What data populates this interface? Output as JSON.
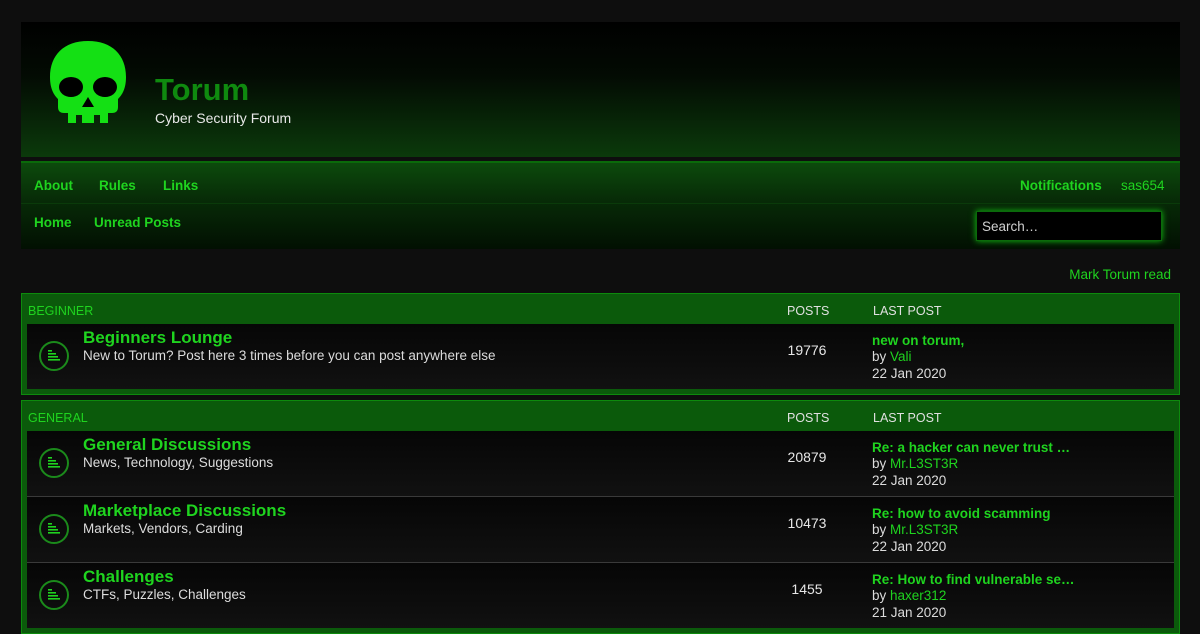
{
  "header": {
    "title": "Torum",
    "subtitle": "Cyber Security Forum",
    "logo_icon": "skull-icon"
  },
  "nav": {
    "about": "About",
    "rules": "Rules",
    "links": "Links",
    "notifications": "Notifications",
    "username": "sas654",
    "home": "Home",
    "unread": "Unread Posts",
    "search_placeholder": "Search…"
  },
  "mark_read": "Mark Torum read",
  "colors": {
    "accent": "#1fd41f",
    "dark_green": "#0f8a0f",
    "background": "#0e0e0e"
  },
  "sections": [
    {
      "title": "BEGINNER",
      "posts_header": "POSTS",
      "last_post_header": "LAST POST",
      "forums": [
        {
          "title": "Beginners Lounge",
          "description": "New to Torum? Post here 3 times before you can post anywhere else",
          "posts": "19776",
          "last_post": {
            "title": "new on torum,",
            "by": "by",
            "user": "Vali",
            "date": "22 Jan 2020"
          }
        }
      ]
    },
    {
      "title": "GENERAL",
      "posts_header": "POSTS",
      "last_post_header": "LAST POST",
      "forums": [
        {
          "title": "General Discussions",
          "description": "News, Technology, Suggestions",
          "posts": "20879",
          "last_post": {
            "title": "Re: a hacker can never trust …",
            "by": "by",
            "user": "Mr.L3ST3R",
            "date": "22 Jan 2020"
          }
        },
        {
          "title": "Marketplace Discussions",
          "description": "Markets, Vendors, Carding",
          "posts": "10473",
          "last_post": {
            "title": "Re: how to avoid scamming",
            "by": "by",
            "user": "Mr.L3ST3R",
            "date": "22 Jan 2020"
          }
        },
        {
          "title": "Challenges",
          "description": "CTFs, Puzzles, Challenges",
          "posts": "1455",
          "last_post": {
            "title": "Re: How to find vulnerable se…",
            "by": "by",
            "user": "haxer312",
            "date": "21 Jan 2020"
          }
        }
      ]
    }
  ]
}
